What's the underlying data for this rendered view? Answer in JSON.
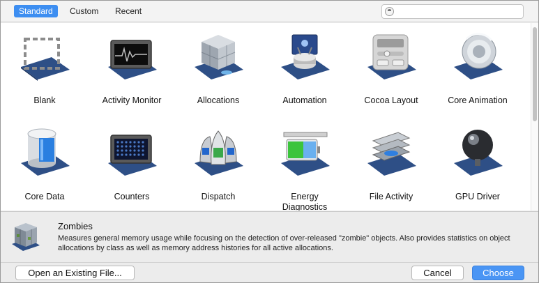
{
  "tabs": [
    "Standard",
    "Custom",
    "Recent"
  ],
  "search": {
    "value": "",
    "placeholder": ""
  },
  "templates": [
    {
      "label": "Blank",
      "icon": "blank-template-icon"
    },
    {
      "label": "Activity Monitor",
      "icon": "activity-monitor-icon"
    },
    {
      "label": "Allocations",
      "icon": "allocations-icon"
    },
    {
      "label": "Automation",
      "icon": "automation-icon"
    },
    {
      "label": "Cocoa Layout",
      "icon": "cocoa-layout-icon"
    },
    {
      "label": "Core Animation",
      "icon": "core-animation-icon"
    },
    {
      "label": "Core Data",
      "icon": "core-data-icon"
    },
    {
      "label": "Counters",
      "icon": "counters-icon"
    },
    {
      "label": "Dispatch",
      "icon": "dispatch-icon"
    },
    {
      "label": "Energy\nDiagnostics",
      "icon": "energy-diagnostics-icon"
    },
    {
      "label": "File Activity",
      "icon": "file-activity-icon"
    },
    {
      "label": "GPU Driver",
      "icon": "gpu-driver-icon"
    }
  ],
  "selected": {
    "title": "Zombies",
    "description": "Measures general memory usage while focusing on the detection of over-released \"zombie\" objects.  Also provides statistics on object allocations by class as well as memory address histories for all active allocations.",
    "icon": "zombies-icon"
  },
  "buttons": {
    "open": "Open an Existing File...",
    "cancel": "Cancel",
    "choose": "Choose"
  },
  "colors": {
    "accent": "#3d8ef1",
    "base_plate": "#2e4f86"
  }
}
